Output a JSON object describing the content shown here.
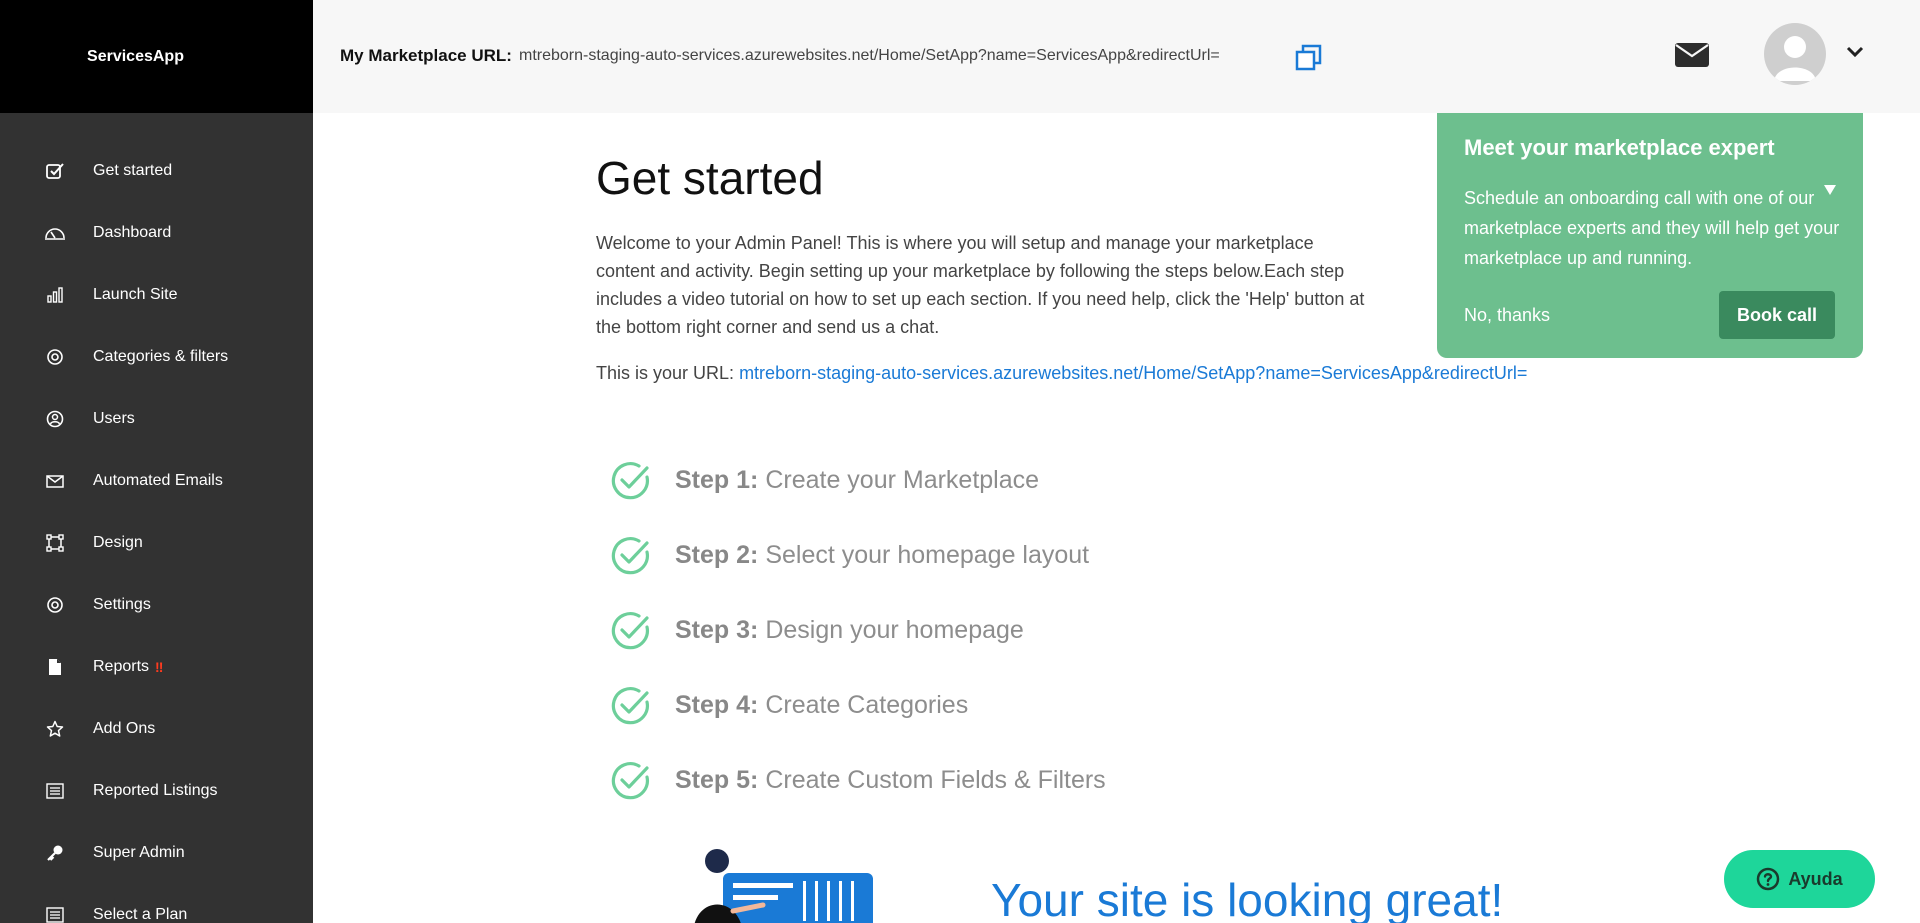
{
  "brand": {
    "name": "ServicesApp"
  },
  "sidebar": {
    "items": [
      {
        "label": "Get started",
        "icon": "check-square-icon"
      },
      {
        "label": "Dashboard",
        "icon": "gauge-icon"
      },
      {
        "label": "Launch Site",
        "icon": "bar-chart-icon"
      },
      {
        "label": "Categories & filters",
        "icon": "gear-icon"
      },
      {
        "label": "Users",
        "icon": "user-circle-icon"
      },
      {
        "label": "Automated Emails",
        "icon": "envelope-icon"
      },
      {
        "label": "Design",
        "icon": "vector-square-icon"
      },
      {
        "label": "Settings",
        "icon": "gear-icon"
      },
      {
        "label": "Reports",
        "icon": "file-icon",
        "badge": "!!"
      },
      {
        "label": "Add Ons",
        "icon": "star-icon"
      },
      {
        "label": "Reported Listings",
        "icon": "list-icon"
      },
      {
        "label": "Super Admin",
        "icon": "key-icon"
      },
      {
        "label": "Select a Plan",
        "icon": "list-icon"
      }
    ]
  },
  "header": {
    "marketplace_label": "My Marketplace URL:",
    "marketplace_url": "mtreborn-staging-auto-services.azurewebsites.net/Home/SetApp?name=ServicesApp&redirectUrl="
  },
  "main": {
    "title": "Get started",
    "welcome": "Welcome to your Admin Panel! This is where you will setup and manage your marketplace content and activity. Begin setting up your marketplace by following the steps below.Each step includes a video tutorial on how to set up each section. If you need help, click the 'Help' button at the bottom right corner and send us a chat.",
    "url_prefix": "This is your URL:",
    "url_link": "mtreborn-staging-auto-services.azurewebsites.net/Home/SetApp?name=ServicesApp&redirectUrl=",
    "steps": [
      {
        "prefix": "Step 1:",
        "text": "Create your Marketplace"
      },
      {
        "prefix": "Step 2:",
        "text": "Select your homepage layout"
      },
      {
        "prefix": "Step 3:",
        "text": "Design your homepage"
      },
      {
        "prefix": "Step 4:",
        "text": "Create Categories"
      },
      {
        "prefix": "Step 5:",
        "text": "Create Custom Fields & Filters"
      }
    ],
    "great_message": "Your site is looking great!"
  },
  "expert_card": {
    "title": "Meet your marketplace expert",
    "body": "Schedule an onboarding call with one of our marketplace experts and they will help get your marketplace up and running.",
    "dismiss_label": "No, thanks",
    "book_label": "Book call"
  },
  "help": {
    "label": "Ayuda"
  },
  "colors": {
    "sidebar_bg": "#323232",
    "brand_bg": "#000000",
    "accent_green": "#6dbf8e",
    "book_btn": "#3a8a5e",
    "link_blue": "#1a7ad6",
    "help_btn": "#1ed69a",
    "step_check": "#6dcf9a",
    "warning": "#ff3b1f"
  }
}
